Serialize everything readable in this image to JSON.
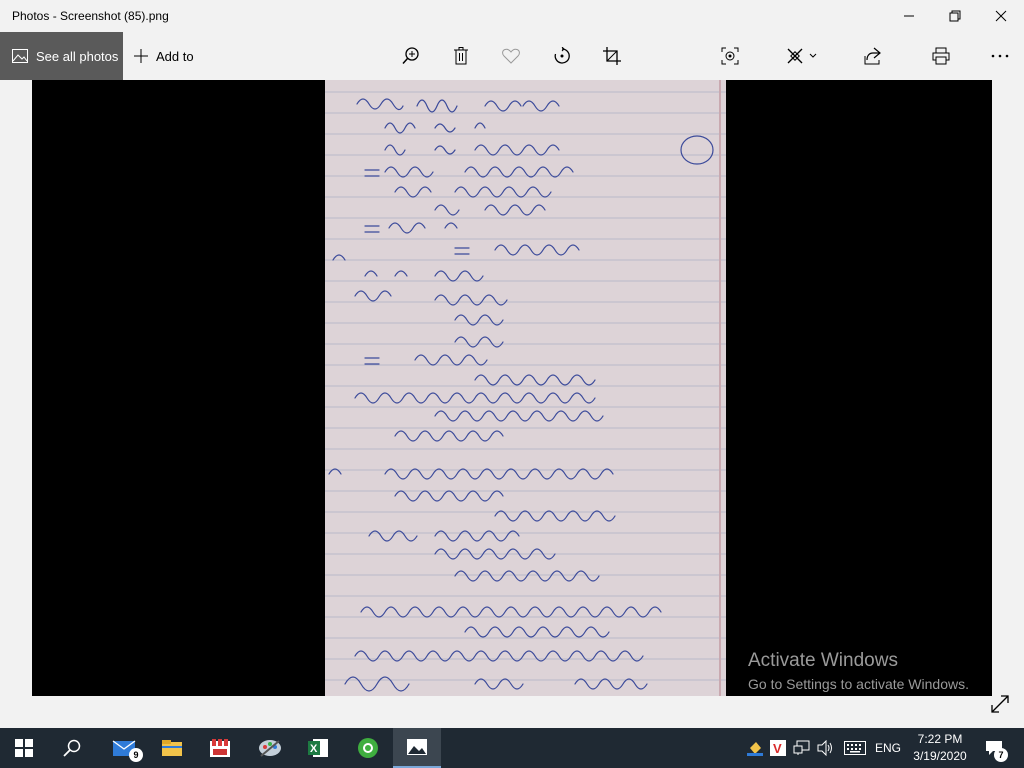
{
  "window": {
    "title": "Photos - Screenshot (85).png"
  },
  "toolbar": {
    "see_all_label": "See all photos",
    "add_to_label": "Add to",
    "icons": [
      "zoom-in-icon",
      "delete-icon",
      "favorite-icon",
      "rotate-icon",
      "crop-icon",
      "enhance-icon",
      "edit-create-icon",
      "share-icon",
      "print-icon",
      "more-icon"
    ]
  },
  "watermark": {
    "line1": "Activate Windows",
    "line2": "Go to Settings to activate Windows."
  },
  "taskbar": {
    "apps": [
      "start",
      "search",
      "mail",
      "file-explorer",
      "paint-app",
      "snip-app",
      "excel",
      "browser",
      "photos"
    ],
    "mail_badge": "9",
    "language": "ENG",
    "time": "7:22 PM",
    "date": "3/19/2020",
    "notification_count": "7"
  },
  "colors": {
    "chrome_bg": "#f2f2f2",
    "see_all_bg": "#5a5a5a",
    "taskbar_bg": "#1f2933",
    "paper": "#ddd3d7",
    "ink": "#3b4a9a",
    "rule_line": "#b9b9c9"
  }
}
